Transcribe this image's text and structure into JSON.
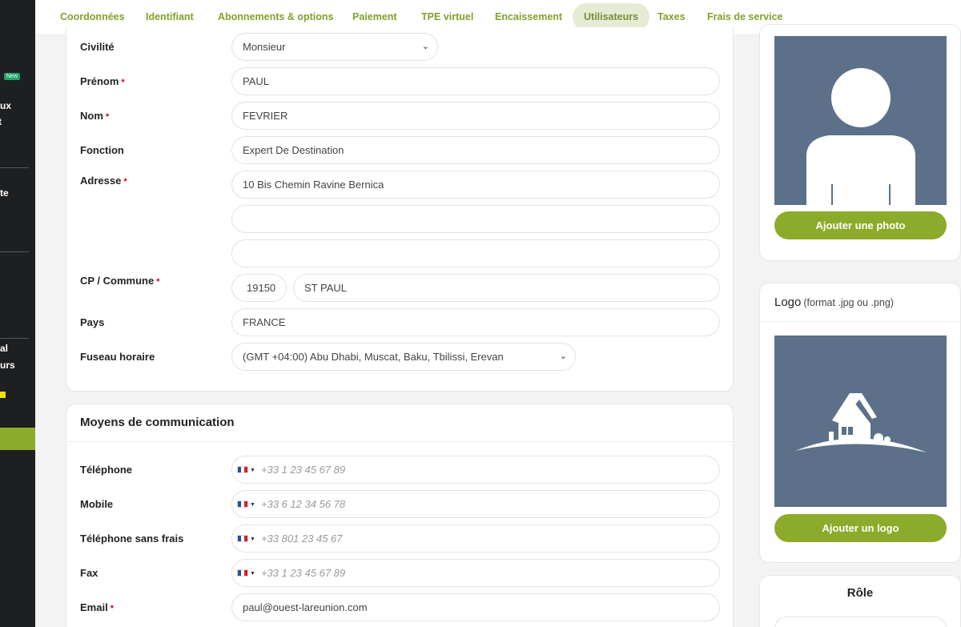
{
  "sidebar": {
    "new_badge": "New",
    "fragments": [
      "ux",
      "t",
      "te",
      "al",
      "urs"
    ]
  },
  "tabs": [
    {
      "label": "Coordonnées",
      "active": false
    },
    {
      "label": "Identifiant",
      "active": false
    },
    {
      "label": "Abonnements & options",
      "active": false
    },
    {
      "label": "Paiement",
      "active": false
    },
    {
      "label": "TPE virtuel",
      "active": false
    },
    {
      "label": "Encaissement",
      "active": false
    },
    {
      "label": "Utilisateurs",
      "active": true
    },
    {
      "label": "Taxes",
      "active": false
    },
    {
      "label": "Frais de service",
      "active": false
    }
  ],
  "form": {
    "civilite": {
      "label": "Civilité",
      "value": "Monsieur"
    },
    "prenom": {
      "label": "Prénom",
      "required": "*",
      "value": "PAUL"
    },
    "nom": {
      "label": "Nom",
      "required": "*",
      "value": "FEVRIER"
    },
    "fonction": {
      "label": "Fonction",
      "value": "Expert De Destination"
    },
    "adresse": {
      "label": "Adresse",
      "required": "*",
      "line1": "10 Bis Chemin Ravine Bernica",
      "line2": "",
      "line3": ""
    },
    "cp_commune": {
      "label": "CP / Commune",
      "required": "*",
      "cp": "19150",
      "commune": "ST PAUL"
    },
    "pays": {
      "label": "Pays",
      "value": "FRANCE"
    },
    "fuseau": {
      "label": "Fuseau horaire",
      "value": "(GMT +04:00) Abu Dhabi, Muscat, Baku, Tbilissi, Erevan"
    }
  },
  "communication": {
    "title": "Moyens de communication",
    "telephone": {
      "label": "Téléphone",
      "placeholder": "+33 1 23 45 67 89"
    },
    "mobile": {
      "label": "Mobile",
      "placeholder": "+33 6 12 34 56 78"
    },
    "sans_frais": {
      "label": "Téléphone sans frais",
      "placeholder": "+33 801 23 45 67"
    },
    "fax": {
      "label": "Fax",
      "placeholder": "+33 1 23 45 67 89"
    },
    "email": {
      "label": "Email",
      "required": "*",
      "value": "paul@ouest-lareunion.com"
    }
  },
  "photo": {
    "button": "Ajouter une photo"
  },
  "logo": {
    "title": "Logo",
    "subtitle": "(format .jpg ou .png)",
    "button": "Ajouter un logo"
  },
  "role": {
    "title": "Rôle"
  },
  "colors": {
    "accent": "#8cab2a",
    "sidebar": "#1e1f21",
    "placeholder_bg": "#5c7189",
    "required": "#d0021b"
  }
}
